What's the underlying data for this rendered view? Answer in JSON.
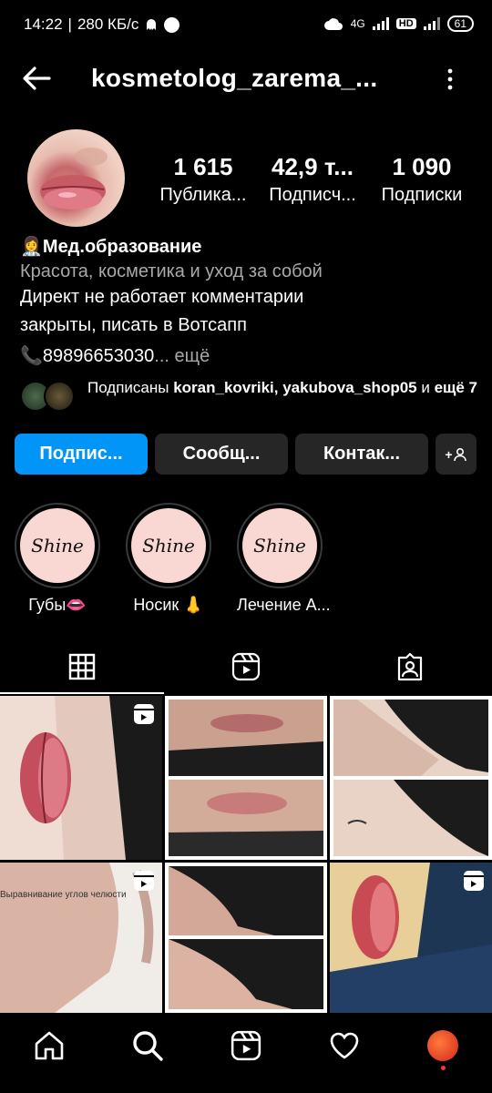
{
  "status": {
    "time": "14:22",
    "speed": "280 КБ/с",
    "network": "4G",
    "hd": "HD",
    "battery": "61"
  },
  "header": {
    "username": "kosmetolog_zarema_..."
  },
  "stats": [
    {
      "value": "1 615",
      "label": "Публика..."
    },
    {
      "value": "42,9 т...",
      "label": "Подписч..."
    },
    {
      "value": "1 090",
      "label": "Подписки"
    }
  ],
  "bio": {
    "title": "👩‍⚕️Мед.образование",
    "category": "Красота, косметика и уход за собой",
    "line1": "Директ не работает комментарии",
    "line2": "закрыты, писать в Вотсапп",
    "phone": "📞89896653030",
    "more": "... ещё"
  },
  "followed_by": {
    "prefix": "Подписаны ",
    "users": "koran_kovriki, yakubova_shop05",
    "and": " и ",
    "more": "ещё 7"
  },
  "buttons": {
    "follow": "Подпис...",
    "message": "Сообщ...",
    "contact": "Контак...",
    "add": "+"
  },
  "highlights": [
    {
      "cover": "Shine",
      "label": "Губы👄"
    },
    {
      "cover": "Shine",
      "label": "Носик 👃"
    },
    {
      "cover": "Shine",
      "label": "Лечение А..."
    }
  ],
  "grid": {
    "overlay_text": "Выравнивание углов челюсти"
  },
  "colors": {
    "accent": "#0095f6",
    "button": "#262626",
    "background": "#000000",
    "notification": "#ff3040"
  }
}
